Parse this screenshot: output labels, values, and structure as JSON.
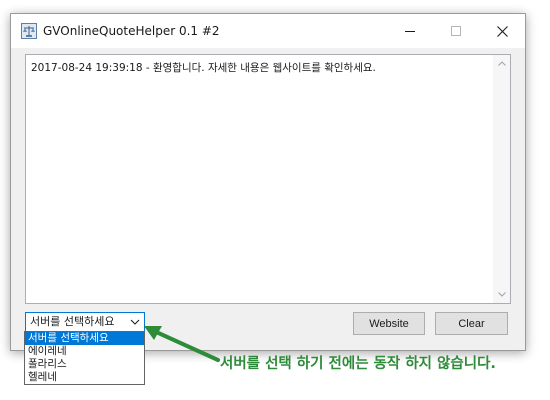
{
  "window": {
    "title": "GVOnlineQuoteHelper 0.1 #2",
    "app_icon": "scale-icon"
  },
  "log": {
    "text": "2017-08-24 19:39:18 - 환영합니다. 자세한 내용은 웹사이트를 확인하세요."
  },
  "server_select": {
    "selected": "서버를 선택하세요",
    "options": [
      "서버를 선택하세요",
      "에이레네",
      "폴라리스",
      "헬레네"
    ]
  },
  "buttons": {
    "website": "Website",
    "clear": "Clear"
  },
  "annotation": {
    "text": "서버를 선택 하기 전에는 동작 하지 않습니다.",
    "color": "#2e8b3a"
  },
  "colors": {
    "accent": "#0078d7"
  }
}
